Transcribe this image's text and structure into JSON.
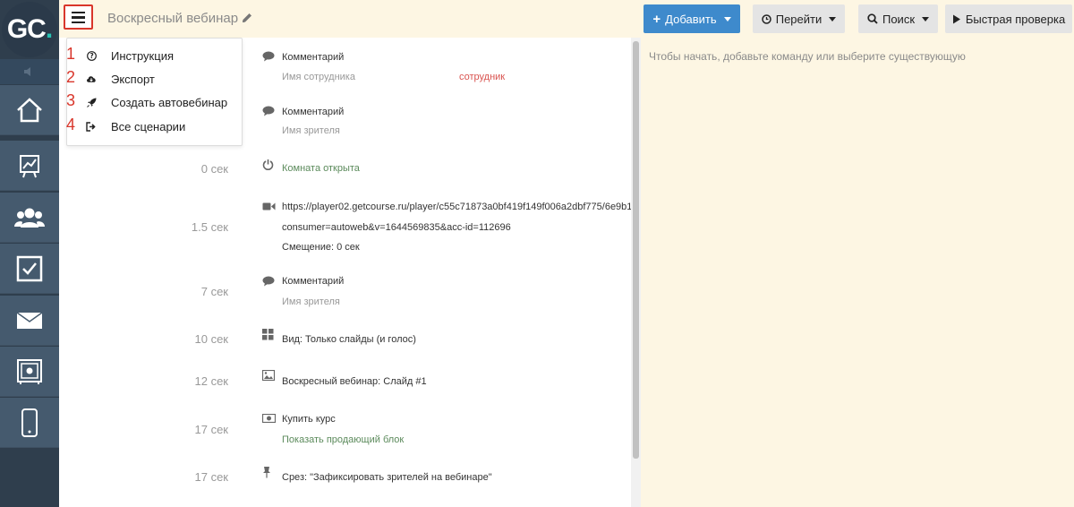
{
  "app": {
    "logo_text": "GC",
    "logo_dot": ".",
    "page_title": "Воскресный вебинар"
  },
  "colors": {
    "sidebar": "#2f3e4d",
    "topbar": "#fdf6e3",
    "accent_blue": "#3e8acc",
    "red_highlight": "#d9362b",
    "green_text": "#5b8a5b"
  },
  "sidebar": {
    "items": [
      {
        "icon": "home-icon"
      },
      {
        "icon": "chart-icon"
      },
      {
        "icon": "users-icon"
      },
      {
        "icon": "checkbox-icon"
      },
      {
        "icon": "mail-icon"
      },
      {
        "icon": "safe-icon"
      },
      {
        "icon": "mobile-icon"
      }
    ]
  },
  "toolbar": {
    "add_label": "Добавить",
    "go_label": "Перейти",
    "search_label": "Поиск",
    "quick_label": "Быстрая проверка"
  },
  "menu": {
    "items": [
      {
        "num": "1",
        "label": "Инструкция",
        "icon": "question-circle-icon"
      },
      {
        "num": "2",
        "label": "Экспорт",
        "icon": "cloud-download-icon"
      },
      {
        "num": "3",
        "label": "Создать автовебинар",
        "icon": "rocket-icon"
      },
      {
        "num": "4",
        "label": "Все сценарии",
        "icon": "sign-out-icon"
      }
    ]
  },
  "right_panel": {
    "hint": "Чтобы начать, добавьте команду или выберите существующую"
  },
  "timeline": {
    "events": [
      {
        "time": "",
        "icon": "comment-icon",
        "title": "Комментарий",
        "sub": "Имя сотрудника",
        "extra": "сотрудник"
      },
      {
        "time": "",
        "icon": "comment-icon",
        "title": "Комментарий",
        "sub": "Имя зрителя"
      },
      {
        "time": "0 сек",
        "icon": "power-icon",
        "title": "Комната открыта"
      },
      {
        "time": "1.5 сек",
        "icon": "video-icon",
        "title": "https://player02.getcourse.ru/player/c55c71873a0bf419f149f006a2dbf775/6e9b1",
        "line2": "consumer=autoweb&v=1644569835&acc-id=112696",
        "line3": "Смещение: 0 сек"
      },
      {
        "time": "7 сек",
        "icon": "comment-icon",
        "title": "Комментарий",
        "sub": "Имя зрителя"
      },
      {
        "time": "10 сек",
        "icon": "layout-icon",
        "title": "Вид: Только слайды (и голос)"
      },
      {
        "time": "12 сек",
        "icon": "image-icon",
        "title": "Воскресный вебинар: Слайд #1"
      },
      {
        "time": "17 сек",
        "icon": "money-icon",
        "title": "Купить курс",
        "sub": "Показать продающий блок"
      },
      {
        "time": "17 сек",
        "icon": "pin-icon",
        "title": "Срез: \"Зафиксировать зрителей на вебинаре\""
      }
    ]
  }
}
